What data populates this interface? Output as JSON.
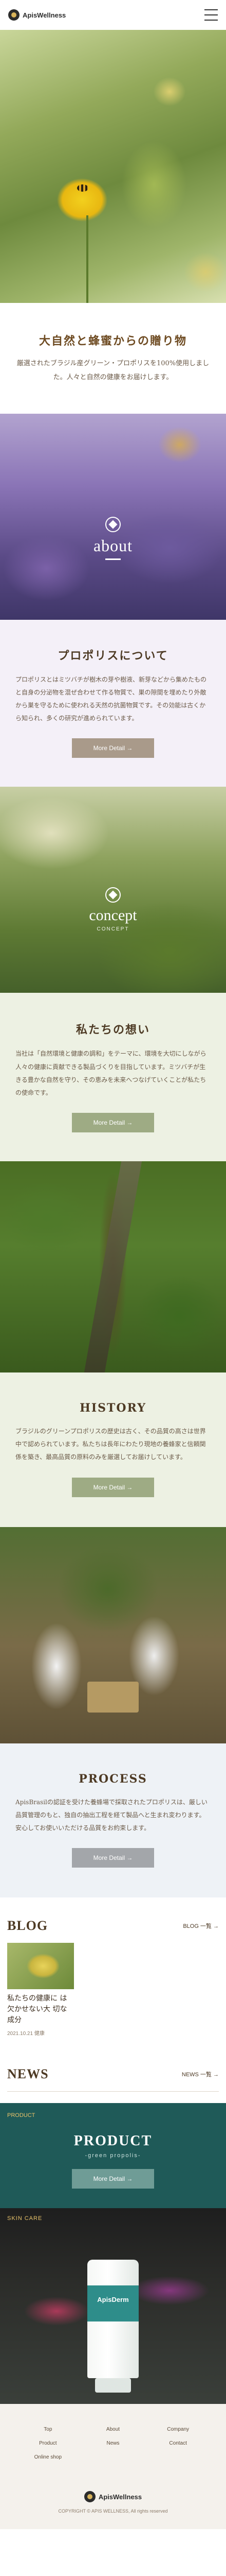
{
  "header": {
    "logo_text": "ApisWellness",
    "menu_icon": "hamburger-icon"
  },
  "intro": {
    "title": "大自然と蜂蜜からの贈り物",
    "text": "厳選されたブラジル産グリーン・プロポリスを100%使用しました。人々と自然の健康をお届けします。"
  },
  "about": {
    "label": "about",
    "icon": "diamond-icon"
  },
  "propolis": {
    "title": "プロポリスについて",
    "text": "プロポリスとはミツバチが樹木の芽や樹液、新芽などから集めたものと自身の分泌物を混ぜ合わせて作る物質で、巣の隙間を埋めたり外敵から巣を守るために使われる天然の抗菌物質です。その効能は古くから知られ、多くの研究が進められています。",
    "button": "More Detail →"
  },
  "concept": {
    "label": "concept",
    "sub": "CONCEPT",
    "icon": "diamond-icon"
  },
  "thoughts": {
    "title": "私たちの想い",
    "text": "当社は「自然環境と健康の調和」をテーマに、環境を大切にしながら人々の健康に貢献できる製品づくりを目指しています。ミツバチが生きる豊かな自然を守り、その恵みを未来へつなげていくことが私たちの使命です。",
    "button": "More Detail →"
  },
  "history": {
    "title": "HISTORY",
    "text": "ブラジルのグリーンプロポリスの歴史は古く、その品質の高さは世界中で認められています。私たちは長年にわたり現地の養蜂家と信頼関係を築き、最高品質の原料のみを厳選してお届けしています。",
    "button": "More Detail →"
  },
  "process": {
    "title": "PROCESS",
    "text": "ApisBrasilの認証を受けた養蜂場で採取されたプロポリスは、厳しい品質管理のもと、独自の抽出工程を経て製品へと生まれ変わります。安心してお使いいただける品質をお約束します。",
    "button": "More Detail →"
  },
  "blog": {
    "title": "BLOG",
    "more": "BLOG 一覧 →",
    "card_title": "私たちの健康に は欠かせない大 切な成分",
    "card_date": "2021.10.21  健康"
  },
  "news": {
    "title": "NEWS",
    "more": "NEWS 一覧 →"
  },
  "product": {
    "tag": "PRODUCT",
    "title": "PRODUCT",
    "sub": "-green propolis-",
    "button": "More Detail →",
    "image_label": "SKIN CARE",
    "tube_brand": "ApisDerm"
  },
  "footer": {
    "links": [
      "Top",
      "About",
      "Company",
      "Product",
      "News",
      "Contact",
      "Online shop"
    ],
    "logo_text": "ApisWellness",
    "copyright": "COPYRIGHT © APIS WELLNESS, All rights reserved"
  }
}
